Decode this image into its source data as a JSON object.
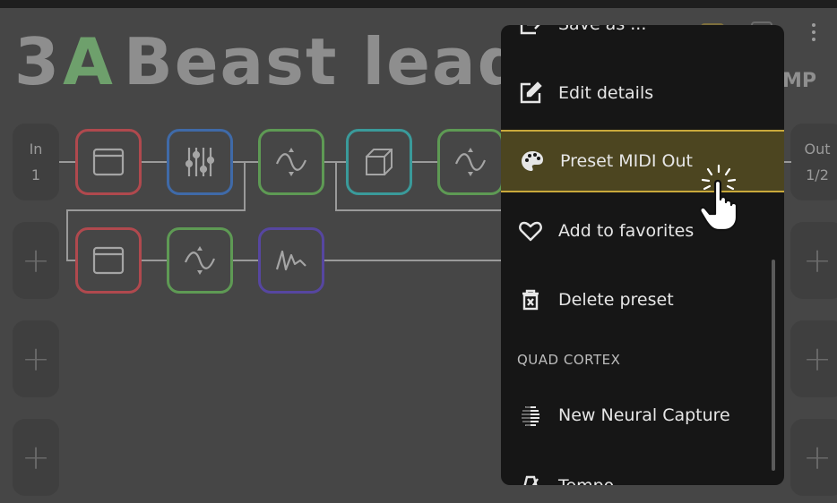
{
  "preset": {
    "bank": "3",
    "slot": "A",
    "name": "Beast lead"
  },
  "header_right": {
    "amp_label": "MP"
  },
  "io": {
    "in_label": "In",
    "in_value": "1",
    "out_label": "Out",
    "out_value": "1/2",
    "plus": "+"
  },
  "blocks_row1": [
    {
      "type": "amp-icon",
      "color": "#b0494e"
    },
    {
      "type": "eq-icon",
      "color": "#3f6aa8"
    },
    {
      "type": "filter-icon",
      "color": "#5e9a54"
    },
    {
      "type": "cab-icon",
      "color": "#3a9a9a"
    },
    {
      "type": "filter-icon",
      "color": "#5e9a54"
    }
  ],
  "blocks_row2": [
    {
      "type": "amp-icon",
      "color": "#b0494e"
    },
    {
      "type": "filter-icon",
      "color": "#5e9a54"
    },
    {
      "type": "wave-icon",
      "color": "#5646a0"
    }
  ],
  "menu": {
    "items": [
      {
        "label": "Save as ...",
        "icon": "save-as-icon"
      },
      {
        "label": "Edit details",
        "icon": "edit-icon"
      },
      {
        "label": "Preset MIDI Out",
        "icon": "palette-icon",
        "highlighted": true
      },
      {
        "label": "Add to favorites",
        "icon": "heart-icon"
      },
      {
        "label": "Delete preset",
        "icon": "trash-icon"
      },
      {
        "label": "New Neural Capture",
        "icon": "capture-icon"
      },
      {
        "label": "Tempo",
        "icon": "metronome-icon"
      }
    ],
    "section_label": "QUAD CORTEX"
  },
  "colors": {
    "highlight_bg": "#4c4520",
    "highlight_border": "#c9a93b",
    "slot_green": "#6ea06c"
  }
}
